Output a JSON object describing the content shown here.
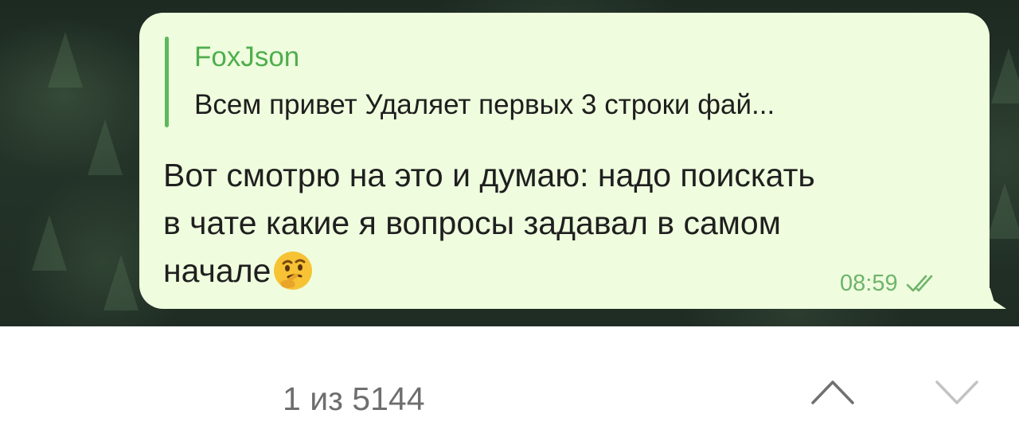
{
  "message": {
    "reply": {
      "author": "FoxJson",
      "text": "Всем привет Удаляет первых 3 строки фай..."
    },
    "text": "Вот смотрю на это и думаю: надо поискать в чате какие я вопросы задавал в самом начале",
    "emoji": "thinking-face",
    "time": "08:59",
    "status": "read"
  },
  "search": {
    "counter": "1 из 5144",
    "up_icon": "chevron-up-icon",
    "down_icon": "chevron-down-icon"
  },
  "colors": {
    "bubble": "#effdde",
    "accent": "#4fae4e",
    "meta": "#6fb46a",
    "icon_active": "#707070",
    "icon_inactive": "#c3c3c3"
  }
}
